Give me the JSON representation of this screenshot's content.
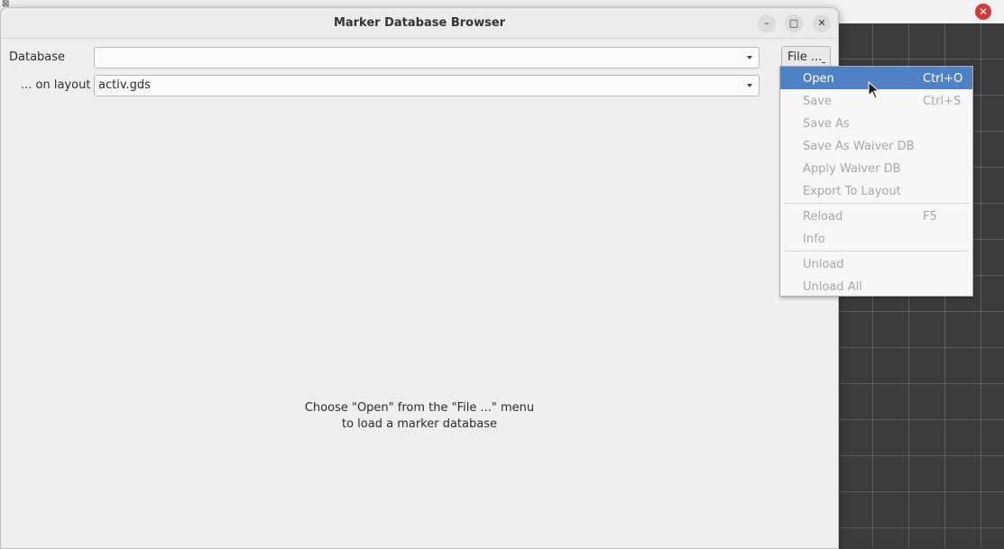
{
  "dialog": {
    "title": "Marker Database Browser",
    "window_buttons": [
      "minimize-icon",
      "maximize-icon",
      "close-icon"
    ]
  },
  "form": {
    "database_label": "Database",
    "database_value": "",
    "layout_label": "... on layout",
    "layout_value": "activ.gds"
  },
  "file_button": {
    "label": "File ..."
  },
  "menu": {
    "items": [
      {
        "label": "Open",
        "shortcut": "Ctrl+O",
        "enabled": true
      },
      {
        "label": "Save",
        "shortcut": "Ctrl+S",
        "enabled": false
      },
      {
        "label": "Save As",
        "shortcut": "",
        "enabled": false
      },
      {
        "label": "Save As Waiver DB",
        "shortcut": "",
        "enabled": false
      },
      {
        "label": "Apply Waiver DB",
        "shortcut": "",
        "enabled": false
      },
      {
        "label": "Export To Layout",
        "shortcut": "",
        "enabled": false
      },
      {
        "label": "Reload",
        "shortcut": "F5",
        "enabled": false
      },
      {
        "label": "Info",
        "shortcut": "",
        "enabled": false
      },
      {
        "label": "Unload",
        "shortcut": "",
        "enabled": false
      },
      {
        "label": "Unload All",
        "shortcut": "",
        "enabled": false
      }
    ]
  },
  "hint": {
    "line1": "Choose \"Open\" from the \"File ...\" menu",
    "line2": "to load a marker database"
  },
  "colors": {
    "menu_highlight": "#4f81c4",
    "background_close": "#d23b3b"
  }
}
